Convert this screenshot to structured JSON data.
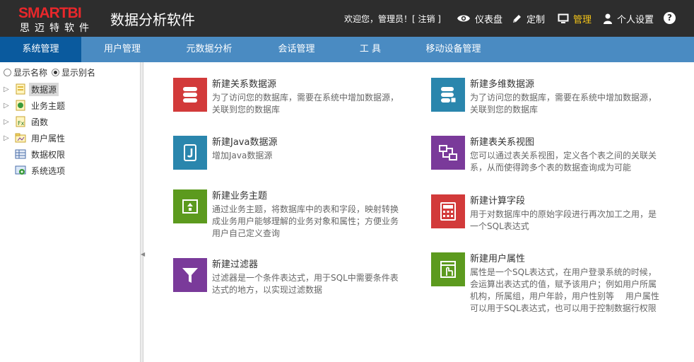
{
  "header": {
    "logo_top": "SMARTBI",
    "logo_bottom": "思迈特软件",
    "app_title": "数据分析软件",
    "welcome": "欢迎您，管理员！[ 注销 ]",
    "items": [
      {
        "label": "仪表盘",
        "icon": "eye-icon"
      },
      {
        "label": "定制",
        "icon": "pencil-icon"
      },
      {
        "label": "管理",
        "icon": "monitor-icon",
        "active": true
      },
      {
        "label": "个人设置",
        "icon": "user-icon"
      }
    ],
    "help": "?",
    "active_color": "#f5c518"
  },
  "nav": {
    "tabs": [
      "系统管理",
      "用户管理",
      "元数据分析",
      "会话管理",
      "工 具",
      "移动设备管理"
    ],
    "active": 0
  },
  "sidebar": {
    "radio_options": [
      "显示名称",
      "显示别名"
    ],
    "radio_selected": 1,
    "tree": [
      {
        "label": "数据源",
        "expandable": true,
        "icon": "datasource-icon",
        "selected": true
      },
      {
        "label": "业务主题",
        "expandable": true,
        "icon": "business-theme-icon"
      },
      {
        "label": "函数",
        "expandable": true,
        "icon": "function-icon"
      },
      {
        "label": "用户属性",
        "expandable": true,
        "icon": "user-attribute-icon"
      },
      {
        "label": "数据权限",
        "expandable": false,
        "icon": "data-permission-icon"
      },
      {
        "label": "系统选项",
        "expandable": false,
        "icon": "system-options-icon"
      }
    ]
  },
  "cards": [
    {
      "title": "新建关系数据源",
      "desc": "为了访问您的数据库，需要在系统中增加数据源，关联到您的数据库",
      "color": "#d23a3a",
      "icon": "relational-datasource-icon"
    },
    {
      "title": "新建多维数据源",
      "desc": "为了访问您的数据库，需要在系统中增加数据源，关联到您的数据库",
      "color": "#2a86ad",
      "icon": "multidim-datasource-icon"
    },
    {
      "title": "新建Java数据源",
      "desc": "增加Java数据源",
      "color": "#2a86ad",
      "icon": "java-datasource-icon"
    },
    {
      "title": "新建表关系视图",
      "desc": "您可以通过表关系视图，定义各个表之间的关联关系，从而使得跨多个表的数据查询成为可能",
      "color": "#7a3a9a",
      "icon": "table-relation-icon"
    },
    {
      "title": "新建业务主题",
      "desc": "通过业务主题，将数据库中的表和字段，映射转换成业务用户能够理解的业务对象和属性；方便业务用户自己定义查询",
      "color": "#5c9a1e",
      "icon": "business-theme-icon"
    },
    {
      "title": "新建计算字段",
      "desc": "用于对数据库中的原始字段进行再次加工之用，是一个SQL表达式",
      "color": "#d23a3a",
      "icon": "calculator-icon"
    },
    {
      "title": "新建过滤器",
      "desc": "过滤器是一个条件表达式，用于SQL中需要条件表达式的地方，以实现过滤数据",
      "color": "#7a3a9a",
      "icon": "filter-icon"
    },
    {
      "title": "新建用户属性",
      "desc": "属性是一个SQL表达式，在用户登录系统的时候，会运算出表达式的值，赋予该用户；例如用户所属机构，所属组，用户年龄，用户性别等　 用户属性可以用于SQL表达式，也可以用于控制数据行权限",
      "color": "#5c9a1e",
      "icon": "user-attribute-icon"
    }
  ]
}
